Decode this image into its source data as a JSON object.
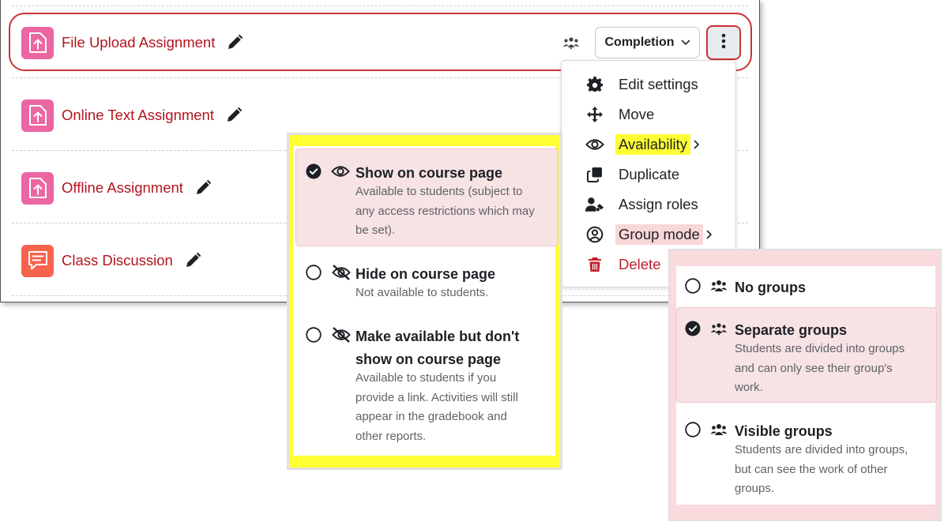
{
  "activities": [
    {
      "name": "File Upload Assignment",
      "icon": "assignment-icon"
    },
    {
      "name": "Online Text Assignment",
      "icon": "assignment-icon"
    },
    {
      "name": "Offline Assignment",
      "icon": "assignment-icon"
    },
    {
      "name": "Class Discussion",
      "icon": "forum-icon"
    }
  ],
  "toolbar": {
    "completion_label": "Completion"
  },
  "action_menu": {
    "items": [
      {
        "label": "Edit settings",
        "icon": "gear-icon"
      },
      {
        "label": "Move",
        "icon": "move-icon"
      },
      {
        "label": "Availability",
        "icon": "eye-icon"
      },
      {
        "label": "Duplicate",
        "icon": "duplicate-icon"
      },
      {
        "label": "Assign roles",
        "icon": "assign-roles-icon"
      },
      {
        "label": "Group mode",
        "icon": "group-mode-icon"
      },
      {
        "label": "Delete",
        "icon": "trash-icon"
      }
    ]
  },
  "availability": {
    "options": [
      {
        "title": "Show on course page",
        "desc": [
          "Available to students (subject to",
          "any access restrictions which may",
          "be set)."
        ],
        "selected": true
      },
      {
        "title": "Hide on course page",
        "desc": [
          "Not available to students."
        ],
        "selected": false
      },
      {
        "title": [
          "Make available but don't",
          "show on course page"
        ],
        "desc": [
          "Available to students if you",
          "provide a link. Activities will still",
          "appear in the gradebook and",
          "other reports."
        ],
        "selected": false
      }
    ]
  },
  "group_mode": {
    "options": [
      {
        "title": "No groups",
        "desc": [],
        "selected": false
      },
      {
        "title": "Separate groups",
        "desc": [
          "Students are divided into groups",
          "and can only see their group's",
          "work."
        ],
        "selected": true
      },
      {
        "title": "Visible groups",
        "desc": [
          "Students are divided into groups,",
          "but can see the work of other",
          "groups."
        ],
        "selected": false
      }
    ]
  },
  "colors": {
    "accent_red": "#c83236",
    "assignment_pink": "#eb66a2",
    "forum_orange": "#f7634d",
    "highlight_yellow": "#ffff33",
    "highlight_pink": "#f9d6d8"
  }
}
